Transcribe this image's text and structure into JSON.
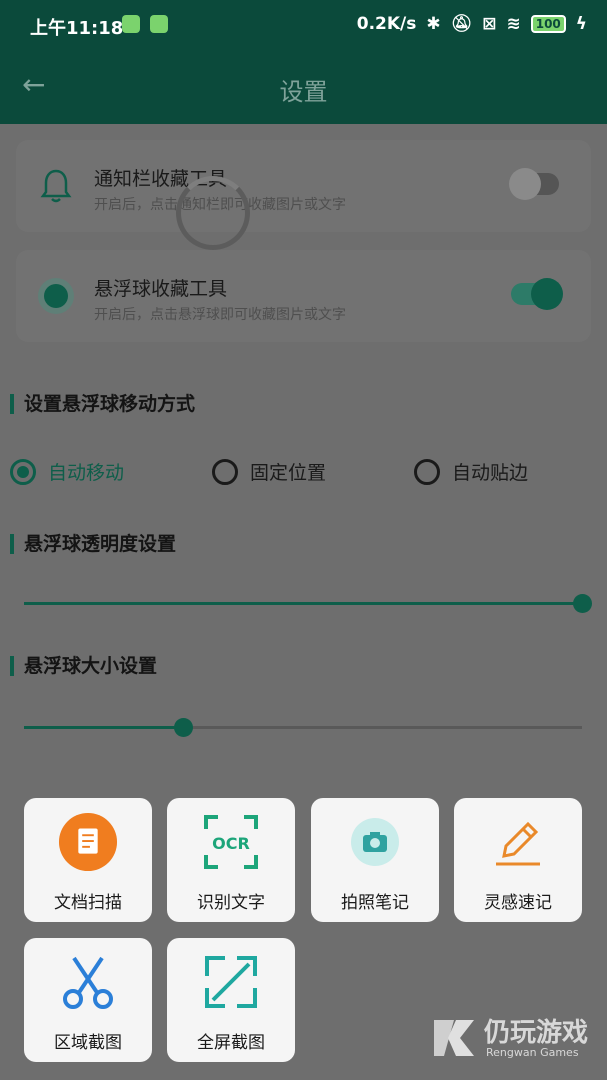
{
  "status_bar": {
    "time": "上午11:18",
    "network_speed": "0.2K/s",
    "battery": "100"
  },
  "header": {
    "title": "设置",
    "back_icon": "arrow-left-icon"
  },
  "cards": [
    {
      "title": "通知栏收藏工具",
      "desc": "开启后，点击通知栏即可收藏图片或文字",
      "icon": "bell-icon",
      "toggle": "off"
    },
    {
      "title": "悬浮球收藏工具",
      "desc": "开启后，点击悬浮球即可收藏图片或文字",
      "icon": "float-ball-icon",
      "toggle": "on"
    }
  ],
  "move_mode": {
    "title": "设置悬浮球移动方式",
    "options": [
      "自动移动",
      "固定位置",
      "自动贴边"
    ],
    "selected": "自动移动"
  },
  "opacity": {
    "title": "悬浮球透明度设置",
    "value": 1.0
  },
  "size": {
    "title": "悬浮球大小设置",
    "value": 0.285
  },
  "tools": [
    {
      "label": "文档扫描",
      "icon": "document-scan-icon"
    },
    {
      "label": "识别文字",
      "icon": "ocr-icon"
    },
    {
      "label": "拍照笔记",
      "icon": "camera-icon"
    },
    {
      "label": "灵感速记",
      "icon": "pencil-icon"
    },
    {
      "label": "区域截图",
      "icon": "scissors-icon"
    },
    {
      "label": "全屏截图",
      "icon": "fullscreen-icon"
    }
  ],
  "watermark": {
    "title": "仍玩游戏",
    "subtitle": "Rengwan Games"
  },
  "colors": {
    "primary": "#0e5e4a",
    "header_bg": "#0b4a3b",
    "overlay": "#6e6e6e"
  }
}
